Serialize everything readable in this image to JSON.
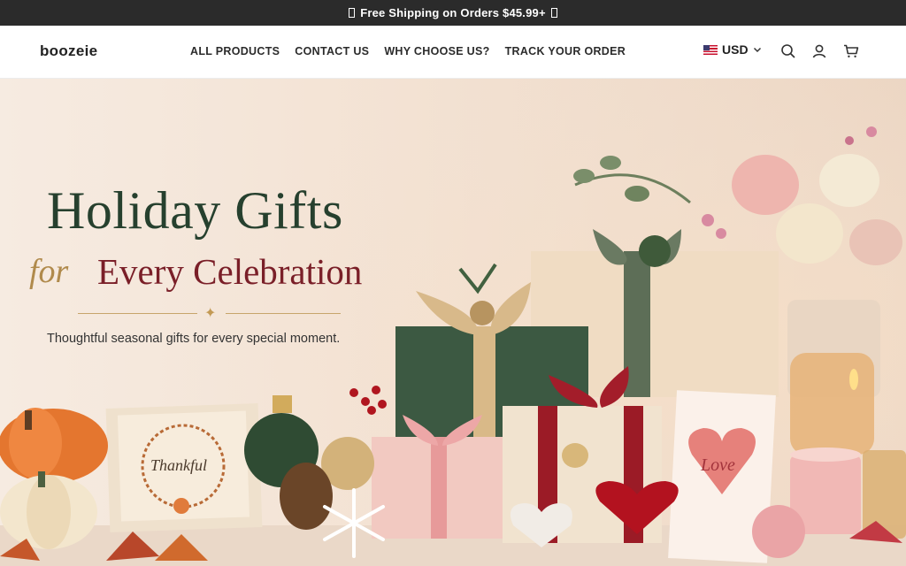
{
  "announcement": {
    "text": "Free Shipping on Orders $45.99+"
  },
  "header": {
    "logo": "boozeie",
    "nav": [
      "ALL PRODUCTS",
      "CONTACT US",
      "WHY CHOOSE US?",
      "TRACK YOUR ORDER"
    ],
    "currency": "USD",
    "icons": [
      "search-icon",
      "account-icon",
      "cart-icon"
    ]
  },
  "hero": {
    "title": "Holiday Gifts",
    "subtitle_script": "for",
    "subtitle": "Every Celebration",
    "tagline": "Thoughtful seasonal gifts for every special moment.",
    "card_thankful": "Thankful",
    "card_love": "Love"
  },
  "colors": {
    "topbar": "#2b2b2b",
    "title_green": "#26402e",
    "subtitle_burgundy": "#7a1f28",
    "accent_gold": "#b08a4c"
  }
}
